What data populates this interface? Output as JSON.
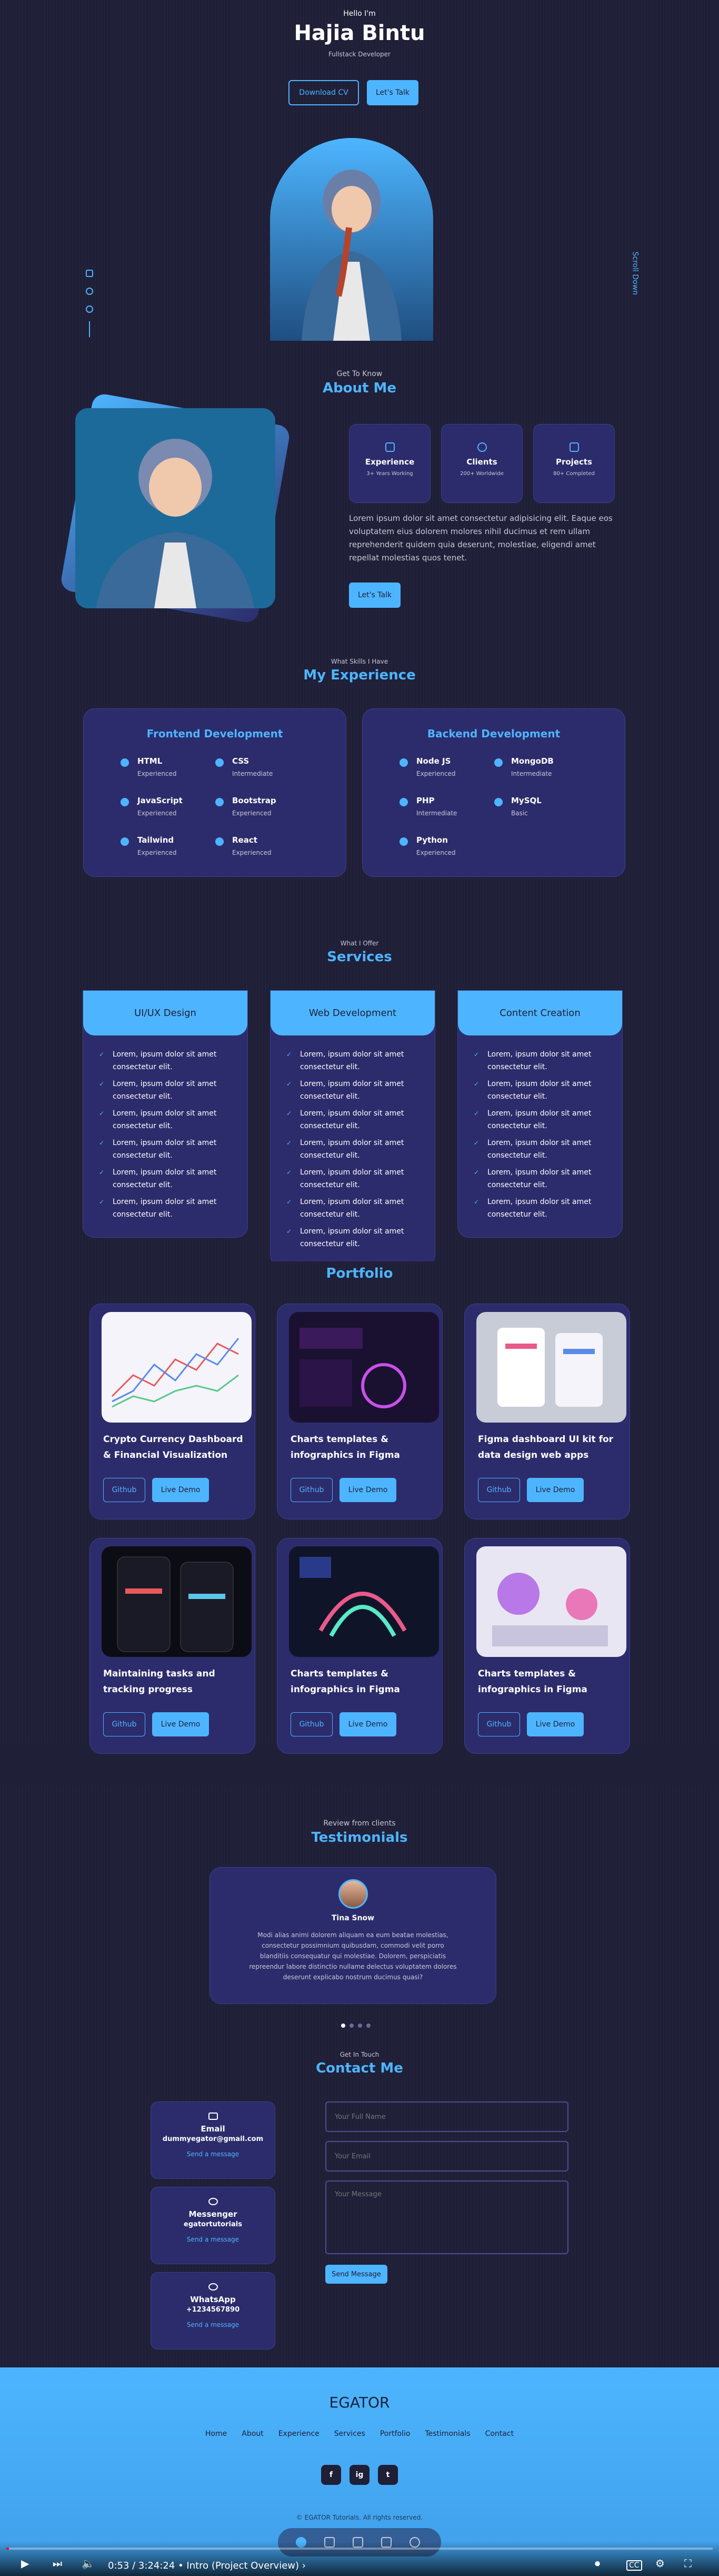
{
  "header": {
    "hello": "Hello I'm",
    "name": "Hajia Bintu",
    "role": "Fullstack Developer",
    "download_cv": "Download CV",
    "lets_talk": "Let's Talk",
    "scroll_down": "Scroll Down"
  },
  "about": {
    "subtitle": "Get To Know",
    "title": "About Me",
    "cards": [
      {
        "title": "Experience",
        "sub": "3+ Years Working"
      },
      {
        "title": "Clients",
        "sub": "200+ Worldwide"
      },
      {
        "title": "Projects",
        "sub": "80+ Completed"
      }
    ],
    "text": "Lorem ipsum dolor sit amet consectetur adipisicing elit. Eaque eos voluptatem eius dolorem molores nihil ducimus et rem ullam reprehenderit quidem quia deserunt, molestiae, eligendi amet repellat molestias quos tenet.",
    "button": "Let's Talk"
  },
  "experience": {
    "subtitle": "What Skills I Have",
    "title": "My Experience",
    "frontend": {
      "title": "Frontend Development",
      "skills": [
        {
          "name": "HTML",
          "level": "Experienced"
        },
        {
          "name": "CSS",
          "level": "Intermediate"
        },
        {
          "name": "JavaScript",
          "level": "Experienced"
        },
        {
          "name": "Bootstrap",
          "level": "Experienced"
        },
        {
          "name": "Tailwind",
          "level": "Experienced"
        },
        {
          "name": "React",
          "level": "Experienced"
        }
      ]
    },
    "backend": {
      "title": "Backend Development",
      "skills": [
        {
          "name": "Node JS",
          "level": "Experienced"
        },
        {
          "name": "MongoDB",
          "level": "Intermediate"
        },
        {
          "name": "PHP",
          "level": "Intermediate"
        },
        {
          "name": "MySQL",
          "level": "Basic"
        },
        {
          "name": "Python",
          "level": "Experienced"
        }
      ]
    }
  },
  "services": {
    "subtitle": "What I Offer",
    "title": "Services",
    "cards": [
      {
        "title": "UI/UX Design",
        "items": [
          "Lorem, ipsum dolor sit amet consectetur elit.",
          "Lorem, ipsum dolor sit amet consectetur elit.",
          "Lorem, ipsum dolor sit amet consectetur elit.",
          "Lorem, ipsum dolor sit amet consectetur elit.",
          "Lorem, ipsum dolor sit amet consectetur elit.",
          "Lorem, ipsum dolor sit amet consectetur elit."
        ]
      },
      {
        "title": "Web Development",
        "items": [
          "Lorem, ipsum dolor sit amet consectetur elit.",
          "Lorem, ipsum dolor sit amet consectetur elit.",
          "Lorem, ipsum dolor sit amet consectetur elit.",
          "Lorem, ipsum dolor sit amet consectetur elit.",
          "Lorem, ipsum dolor sit amet consectetur elit.",
          "Lorem, ipsum dolor sit amet consectetur elit.",
          "Lorem, ipsum dolor sit amet consectetur elit."
        ]
      },
      {
        "title": "Content Creation",
        "items": [
          "Lorem, ipsum dolor sit amet consectetur elit.",
          "Lorem, ipsum dolor sit amet consectetur elit.",
          "Lorem, ipsum dolor sit amet consectetur elit.",
          "Lorem, ipsum dolor sit amet consectetur elit.",
          "Lorem, ipsum dolor sit amet consectetur elit.",
          "Lorem, ipsum dolor sit amet consectetur elit."
        ]
      }
    ]
  },
  "portfolio": {
    "title": "Portfolio",
    "items": [
      {
        "title": "Crypto Currency Dashboard & Financial Visualization",
        "github": "Github",
        "demo": "Live Demo"
      },
      {
        "title": "Charts templates & infographics in Figma",
        "github": "Github",
        "demo": "Live Demo"
      },
      {
        "title": "Figma dashboard UI kit for data design web apps",
        "github": "Github",
        "demo": "Live Demo"
      },
      {
        "title": "Maintaining tasks and tracking progress",
        "github": "Github",
        "demo": "Live Demo"
      },
      {
        "title": "Charts templates & infographics in Figma",
        "github": "Github",
        "demo": "Live Demo"
      },
      {
        "title": "Charts templates & infographics in Figma",
        "github": "Github",
        "demo": "Live Demo"
      }
    ]
  },
  "testimonials": {
    "subtitle": "Review from clients",
    "title": "Testimonials",
    "name": "Tina Snow",
    "text": "Modi alias animi dolorem aliquam ea eum beatae molestias, consectetur possimnium quibusdam, commodi velit porro blanditiis consequatur qui molestiae. Dolorem, perspiciatis repreendur labore distinctio nullame delectus voluptatem dolores deserunt explicabo nostrum ducimus quasi?"
  },
  "contact": {
    "subtitle": "Get In Touch",
    "title": "Contact Me",
    "cards": [
      {
        "title": "Email",
        "value": "dummyegator@gmail.com",
        "action": "Send a message"
      },
      {
        "title": "Messenger",
        "value": "egatortutorials",
        "action": "Send a message"
      },
      {
        "title": "WhatsApp",
        "value": "+1234567890",
        "action": "Send a message"
      }
    ],
    "name_placeholder": "Your Full Name",
    "email_placeholder": "Your Email",
    "message_placeholder": "Your Message",
    "send": "Send Message"
  },
  "footer": {
    "logo": "EGATOR",
    "nav": [
      "Home",
      "About",
      "Experience",
      "Services",
      "Portfolio",
      "Testimonials",
      "Contact"
    ],
    "social": [
      "f",
      "ig",
      "t"
    ],
    "copyright": "© EGATOR Tutorials. All rights reserved."
  },
  "player": {
    "time": "0:53 / 3:24:24",
    "chapter": "• Intro (Project Overview) ›",
    "progress": 0.004
  }
}
